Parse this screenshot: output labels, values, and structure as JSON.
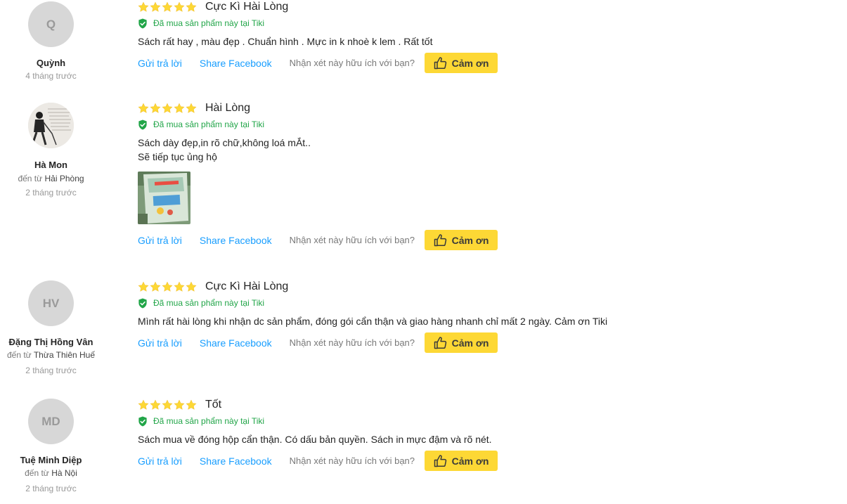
{
  "common": {
    "bought_label": "Đã mua sản phẩm này tại Tiki",
    "reply_label": "Gửi trả lời",
    "share_label": "Share Facebook",
    "helpful_label": "Nhận xét này hữu ích với bạn?",
    "thanks_label": "Cảm ơn",
    "from_prefix": "đến từ"
  },
  "colors": {
    "accent_yellow": "#fdd835",
    "link_blue": "#189eff",
    "verified_green": "#21a548",
    "star": "#fdd835"
  },
  "reviews": [
    {
      "avatar_initials": "Q",
      "user_name": "Quỳnh",
      "location": "",
      "time": "4 tháng trước",
      "rating": 5,
      "title": "Cực Kì Hài Lòng",
      "text": "Sách rất hay , màu đẹp . Chuẩn hình . Mực in k nhoè k lem . Rất tốt"
    },
    {
      "avatar_initials": "",
      "user_name": "Hà Mon",
      "location": "Hải Phòng",
      "time": "2 tháng trước",
      "rating": 5,
      "title": "Hài Lòng",
      "text_line1": "Sách dày đẹp,in rõ chữ,không loá mẮt..",
      "text_line2": "Sẽ tiếp tục ủng hộ"
    },
    {
      "avatar_initials": "HV",
      "user_name": "Đặng Thị Hồng Vân",
      "location": "Thừa Thiên Huế",
      "time": "2 tháng trước",
      "rating": 5,
      "title": "Cực Kì Hài Lòng",
      "text": "Mình rất hài lòng khi nhận dc sản phẩm, đóng gói cẩn thận và giao hàng nhanh chỉ mất 2 ngày. Cảm ơn Tiki"
    },
    {
      "avatar_initials": "MD",
      "user_name": "Tuệ Minh Diệp",
      "location": "Hà Nội",
      "time": "2 tháng trước",
      "rating": 5,
      "title": "Tốt",
      "text": "Sách mua về đóng hộp cẩn thận. Có dấu bản quyền. Sách in mực đậm và rõ nét."
    }
  ]
}
